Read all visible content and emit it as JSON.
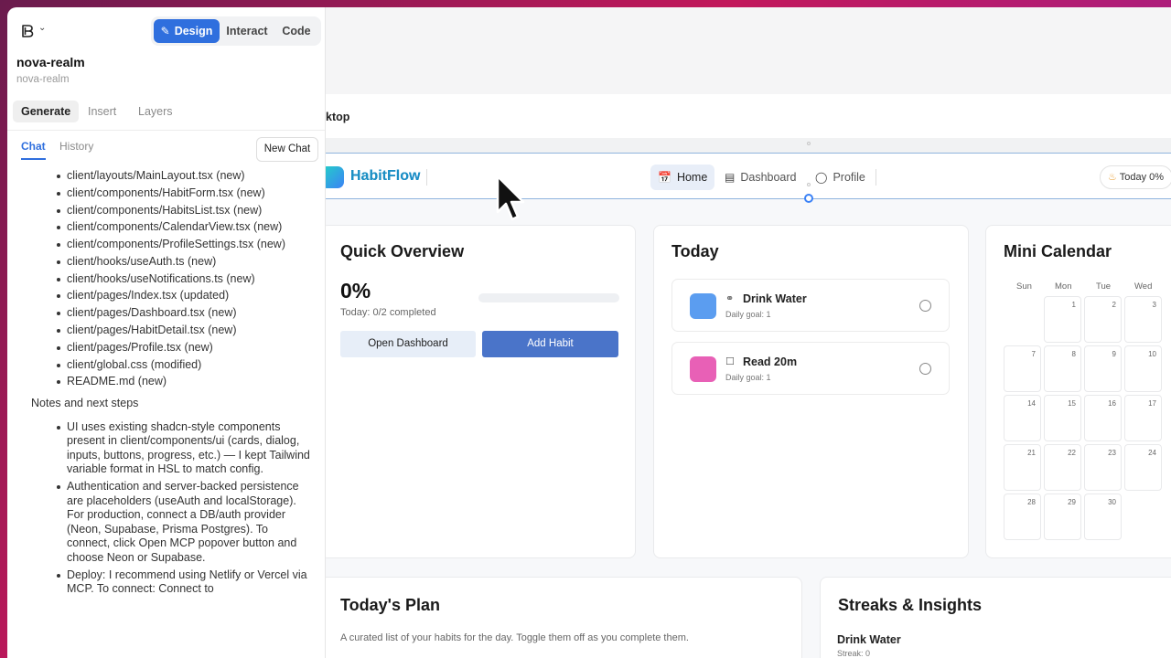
{
  "editor": {
    "modes": [
      "Design",
      "Interact",
      "Code"
    ],
    "project_title": "nova-realm",
    "project_sub": "nova-realm",
    "main_tabs": [
      "Generate",
      "Insert",
      "Layers"
    ],
    "chat_tabs": [
      "Chat",
      "History"
    ],
    "new_chat": "New Chat"
  },
  "chat": {
    "files": [
      "client/layouts/MainLayout.tsx (new)",
      "client/components/HabitForm.tsx (new)",
      "client/components/HabitsList.tsx (new)",
      "client/components/CalendarView.tsx (new)",
      "client/components/ProfileSettings.tsx (new)",
      "client/hooks/useAuth.ts (new)",
      "client/hooks/useNotifications.ts (new)",
      "client/pages/Index.tsx (updated)",
      "client/pages/Dashboard.tsx (new)",
      "client/pages/HabitDetail.tsx (new)",
      "client/pages/Profile.tsx (new)",
      "client/global.css (modified)",
      "README.md (new)"
    ],
    "notes_heading": "Notes and next steps",
    "notes": [
      "UI uses existing shadcn-style components present in client/components/ui (cards, dialog, inputs, buttons, progress, etc.) — I kept Tailwind variable format in HSL to match config.",
      "Authentication and server-backed persistence are placeholders (useAuth and localStorage). For production, connect a DB/auth provider (Neon, Supabase, Prisma Postgres). To connect, click Open MCP popover button and choose Neon or Supabase.",
      "Deploy: I recommend using Netlify or Vercel via MCP. To connect: Connect to"
    ]
  },
  "canvas": {
    "frame_label": "ktop"
  },
  "app": {
    "brand": "HabitFlow",
    "nav": [
      {
        "label": "Home",
        "icon": "calendar-icon"
      },
      {
        "label": "Dashboard",
        "icon": "bar-chart-icon"
      },
      {
        "label": "Profile",
        "icon": "user-icon"
      }
    ],
    "today_pill": "Today 0%",
    "quick_overview": {
      "title": "Quick Overview",
      "percent": "0%",
      "progress": 0,
      "subtitle": "Today: 0/2 completed",
      "btn_dashboard": "Open Dashboard",
      "btn_add": "Add Habit"
    },
    "today": {
      "title": "Today",
      "habits": [
        {
          "name": "Drink Water",
          "goal": "Daily goal: 1",
          "color": "#5b9df0",
          "icon": "drop-icon"
        },
        {
          "name": "Read 20m",
          "goal": "Daily goal: 1",
          "color": "#e860b6",
          "icon": "book-icon"
        }
      ]
    },
    "calendar": {
      "title": "Mini Calendar",
      "weekdays": [
        "Sun",
        "Mon",
        "Tue",
        "Wed"
      ],
      "days": [
        "1",
        "2",
        "3",
        "7",
        "8",
        "9",
        "10",
        "14",
        "15",
        "16",
        "17",
        "21",
        "22",
        "23",
        "24",
        "28",
        "29",
        "30"
      ]
    },
    "plan": {
      "title": "Today's Plan",
      "subtitle": "A curated list of your habits for the day. Toggle them off as you complete them."
    },
    "streaks": {
      "title": "Streaks & Insights",
      "name": "Drink Water",
      "value": "Streak: 0"
    }
  },
  "colors": {
    "accent": "#2f6fde",
    "primary_button": "#4a74c9",
    "light_button": "#e7eef8"
  }
}
